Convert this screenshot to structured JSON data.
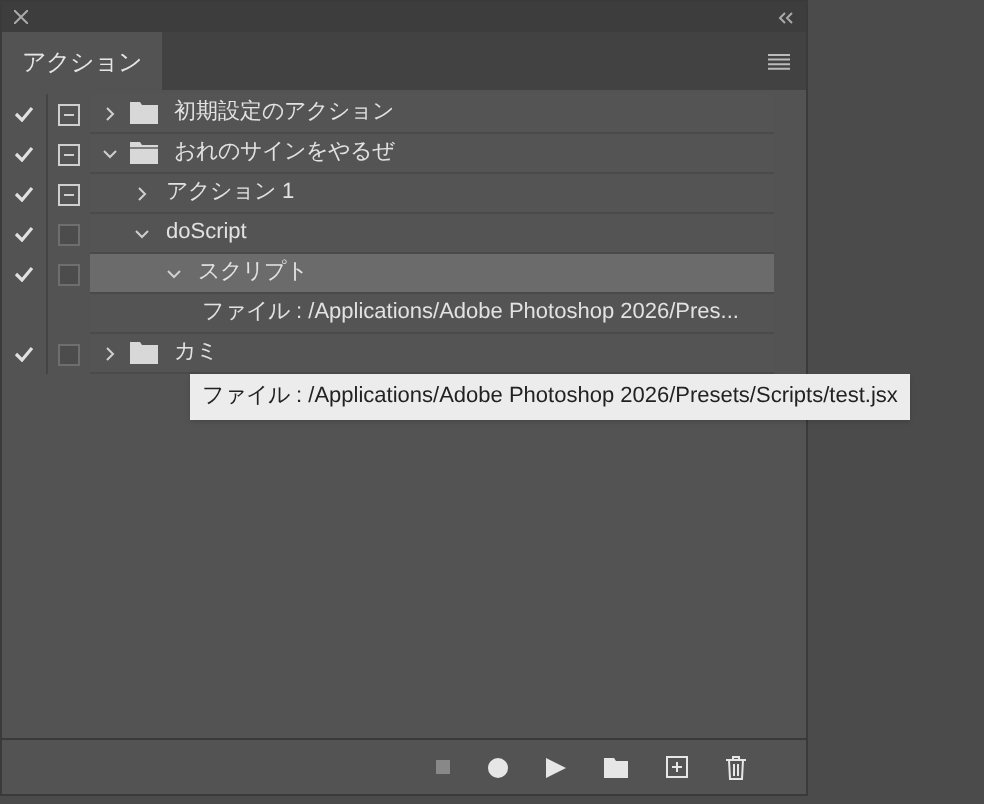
{
  "panel": {
    "tab": {
      "label": "アクション",
      "selected": true
    }
  },
  "actions": [
    {
      "kind": "set",
      "label": "初期設定のアクション",
      "checked": true,
      "dialog": true,
      "expanded": false,
      "selected": false
    },
    {
      "kind": "set",
      "label": "おれのサインをやるぜ",
      "checked": true,
      "dialog": true,
      "expanded": true,
      "selected": false,
      "children": [
        {
          "kind": "action",
          "label": "アクション 1",
          "checked": true,
          "dialog": true,
          "expanded": false,
          "selected": false
        },
        {
          "kind": "action",
          "label": "doScript",
          "checked": true,
          "dialog": false,
          "expanded": true,
          "selected": false,
          "children": [
            {
              "kind": "command",
              "label": "スクリプト",
              "checked": true,
              "dialog": false,
              "expanded": true,
              "selected": true,
              "children": [
                {
                  "kind": "detail",
                  "label": "ファイル : /Applications/Adobe Photoshop 2026/Pres..."
                }
              ]
            }
          ]
        }
      ]
    },
    {
      "kind": "set",
      "label": "カミ",
      "checked": true,
      "dialog": false,
      "expanded": false,
      "selected": false
    }
  ],
  "tooltip": "ファイル : /Applications/Adobe Photoshop 2026/Presets/Scripts/test.jsx"
}
